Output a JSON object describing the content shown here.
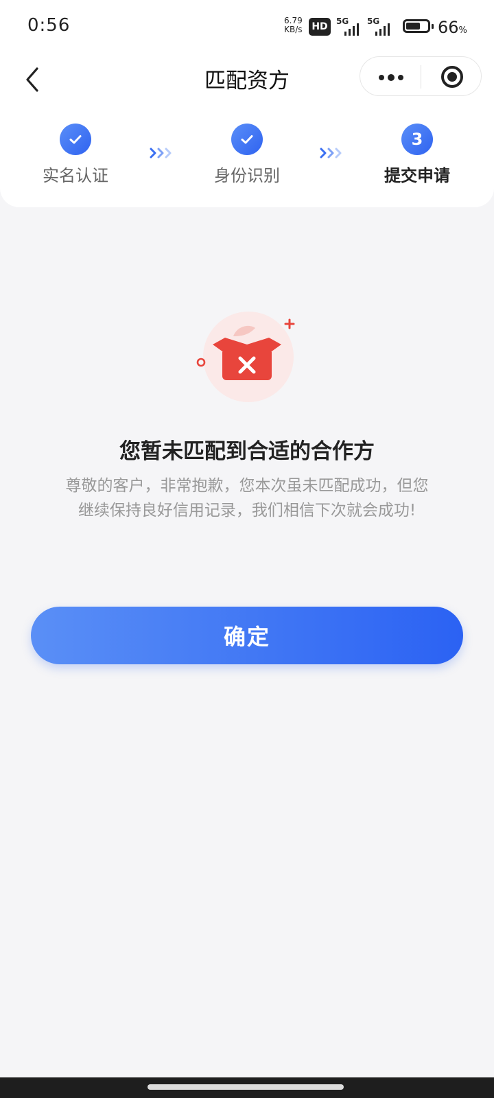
{
  "status_bar": {
    "time": "0:56",
    "net_speed_value": "6.79",
    "net_speed_unit": "KB/s",
    "hd_badge": "HD",
    "signal_1": "5G",
    "signal_2": "5G",
    "battery_percent": "66",
    "battery_unit": "%",
    "battery_level": 0.66
  },
  "nav": {
    "title": "匹配资方",
    "back_icon": "chevron-left-icon",
    "more_icon": "more-dots-icon",
    "close_icon": "target-close-icon"
  },
  "steps": [
    {
      "label": "实名认证",
      "state": "done",
      "icon": "check-icon"
    },
    {
      "label": "身份识别",
      "state": "done",
      "icon": "check-icon"
    },
    {
      "label": "提交申请",
      "state": "active",
      "number": "3"
    }
  ],
  "result": {
    "icon": "error-box-icon",
    "title": "您暂未匹配到合适的合作方",
    "description": "尊敬的客户，非常抱歉，您本次虽未匹配成功，但您继续保持良好信用记录，我们相信下次就会成功!"
  },
  "actions": {
    "confirm_label": "确定"
  },
  "colors": {
    "accent": "#3a6ff2",
    "error": "#e8453c",
    "background": "#f5f5f7"
  }
}
